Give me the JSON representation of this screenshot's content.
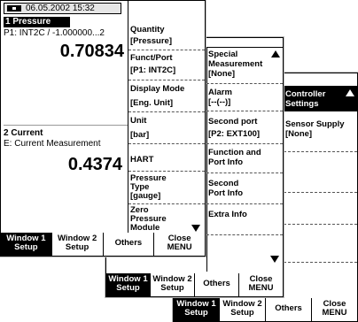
{
  "status": {
    "datetime": "06.05.2002 15:32",
    "battery_icon": "battery-icon"
  },
  "win1": {
    "num": "1",
    "title": "Pressure",
    "source": "P1: INT2C / -1.000000...2",
    "value": "0.70834"
  },
  "win2": {
    "num": "2",
    "title": "Current",
    "source": "E: Current Measurement",
    "value": "0.4374"
  },
  "menu1": {
    "quantity_title": "Quantity",
    "quantity_value": "[Pressure]",
    "funct_title": "Funct/Port",
    "funct_value": "[P1: INT2C]",
    "display_title": "Display Mode",
    "display_value": "[Eng. Unit]",
    "unit_title": "Unit",
    "unit_value": "[bar]",
    "hart": "HART",
    "ptype_l1": "Pressure",
    "ptype_l2": "Type",
    "ptype_l3": "[gauge]",
    "zero_l1": "Zero",
    "zero_l2": "Pressure",
    "zero_l3": "Module"
  },
  "menu2": {
    "special_l1": "Special",
    "special_l2": "Measurement",
    "special_l3": "[None]",
    "alarm_title": "Alarm",
    "alarm_value": "[--(--)]",
    "second_port_title": "Second port",
    "second_port_value": "[P2: EXT100]",
    "function_l1": "Function and",
    "function_l2": "Port Info",
    "second_l1": "Second",
    "second_l2": "Port Info",
    "extra": "Extra Info"
  },
  "menu3": {
    "controller_l1": "Controller",
    "controller_l2": "Settings",
    "sensor_title": "Sensor Supply",
    "sensor_value": "[None]"
  },
  "softkeys": {
    "w1_l1": "Window 1",
    "w1_l2": "Setup",
    "w2_l1": "Window 2",
    "w2_l2": "Setup",
    "others": "Others",
    "close_l1": "Close",
    "close_l2": "MENU"
  }
}
